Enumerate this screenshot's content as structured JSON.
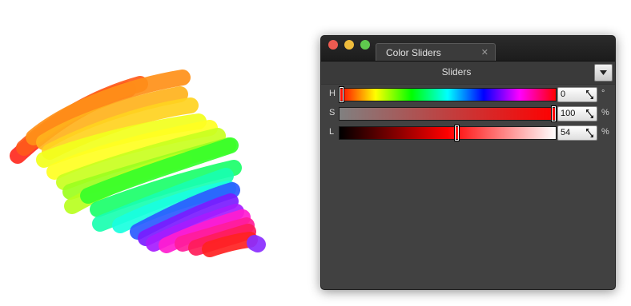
{
  "window": {
    "tab_title": "Color Sliders",
    "tab_close_icon": "close-icon",
    "header_title": "Sliders",
    "menu_icon": "chevron-down-icon"
  },
  "sliders": [
    {
      "id": "hue",
      "label": "H",
      "value": "0",
      "unit": "°",
      "fraction": 0.0
    },
    {
      "id": "saturation",
      "label": "S",
      "value": "100",
      "unit": "%",
      "fraction": 1.0
    },
    {
      "id": "lightness",
      "label": "L",
      "value": "54",
      "unit": "%",
      "fraction": 0.54
    }
  ],
  "colors": {
    "panel_bg": "#414141",
    "titlebar": "#1e1e1e",
    "close_light": "#ee5b51",
    "minimize_light": "#f0bd3c",
    "zoom_light": "#5fc84e",
    "current_color": "#ff1a1a"
  },
  "canvas_strokes": [
    "#ff2a1f",
    "#ff5a1a",
    "#ff8a18",
    "#ffb21c",
    "#ffd21f",
    "#f2ff1c",
    "#c9ff1f",
    "#8cff1e",
    "#35ff2a",
    "#1bff6a",
    "#19ffd0",
    "#22a8ff",
    "#2a3cff",
    "#7a1cff",
    "#d21cff",
    "#ff1cd0",
    "#ff1c6a",
    "#ff2222",
    "#8a2cff"
  ]
}
